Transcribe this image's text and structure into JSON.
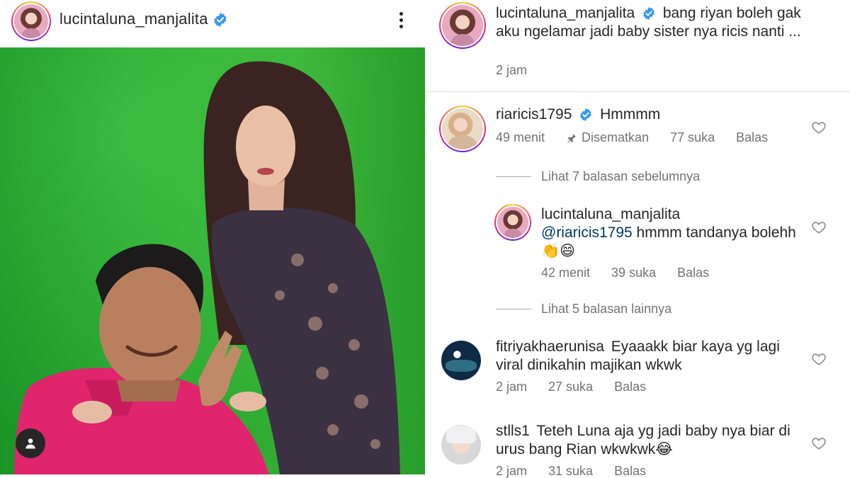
{
  "post": {
    "username": "lucintaluna_manjalita",
    "icons": {
      "more": "more-vertical-icon",
      "verified": "verified-badge-icon",
      "user_tag": "user-tag-icon"
    }
  },
  "caption": {
    "username": "lucintaluna_manjalita",
    "text": "bang riyan boleh gak aku ngelamar jadi baby sister nya ricis nanti ...",
    "time": "2 jam"
  },
  "comments": [
    {
      "username": "riaricis1795",
      "text": "Hmmmm",
      "time": "49 menit",
      "pinned": "Disematkan",
      "likes": "77 suka",
      "reply": "Balas"
    }
  ],
  "view_prev_replies": "Lihat 7 balasan sebelumnya",
  "reply": {
    "username": "lucintaluna_manjalita",
    "mention": "@riaricis1795",
    "text": " hmmm tandanya bolehh 👏😄",
    "time": "42 menit",
    "likes": "39 suka",
    "reply": "Balas"
  },
  "view_more_replies": "Lihat 5 balasan lainnya",
  "comment2": {
    "username": "fitriyakhaerunisa",
    "text": "Eyaaakk biar kaya yg lagi viral dinikahin majikan wkwk",
    "time": "2 jam",
    "likes": "27 suka",
    "reply": "Balas"
  },
  "comment3": {
    "username": "stlls1",
    "text": "Teteh Luna aja yg jadi baby nya biar di urus bang Rian wkwkwk😂",
    "time": "2 jam",
    "likes": "31 suka",
    "reply": "Balas"
  },
  "colors": {
    "verified": "#3897f0",
    "mention": "#00376b",
    "muted": "#737373",
    "green_screen": "#2dbb33"
  }
}
